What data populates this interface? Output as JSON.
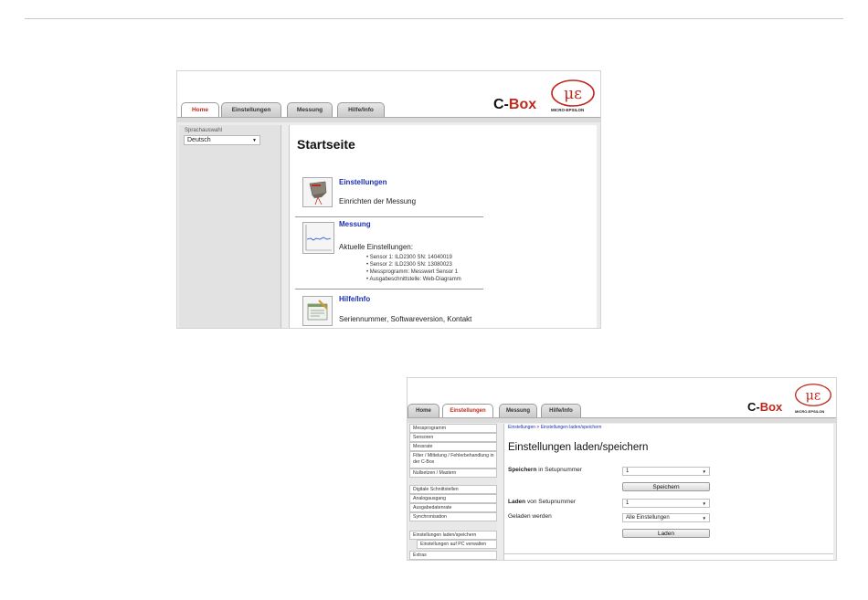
{
  "brand": {
    "prefix": "C-",
    "suffix": "Box",
    "logo_text": "MICRO-EPSILON"
  },
  "tabs": [
    "Home",
    "Einstellungen",
    "Messung",
    "Hilfe/Info"
  ],
  "colors": {
    "accent": "#c0281c",
    "link": "#1a2fb0"
  },
  "home": {
    "language_label": "Sprachauswahl",
    "language_value": "Deutsch",
    "title": "Startseite",
    "items": [
      {
        "icon": "sensor-settings-icon",
        "title": "Einstellungen",
        "desc": "Einrichten der Messung"
      },
      {
        "icon": "measurement-chart-icon",
        "title": "Messung",
        "desc": "Aktuelle Einstellungen:",
        "bullets": [
          "Sensor 1: ILD2300 SN: 14040019",
          "Sensor 2: ILD2300 SN: 13080023",
          "Messprogramm: Messwert Sensor 1",
          "Ausgabeschnittstelle: Web-Diagramm"
        ]
      },
      {
        "icon": "help-info-icon",
        "title": "Hilfe/Info",
        "desc": "Seriennummer, Softwareversion, Kontakt"
      }
    ]
  },
  "settings": {
    "nav_items": [
      "Messprogramm",
      "Sensoren",
      "Messrate",
      "Filter / Mittelung / Fehlerbehandlung in der C-Box",
      "Nullsetzen / Mastern",
      "Digitale Schnittstellen",
      "Analogausgang",
      "Ausgabedatenrate",
      "Synchronisation",
      "Einstellungen laden/speichern",
      "Einstellungen auf PC verwalten",
      "Extras"
    ],
    "breadcrumb": "Einstellungen > Einstellungen laden/speichern",
    "title": "Einstellungen laden/speichern",
    "save_label_bold": "Speichern",
    "save_label_rest": " in Setupnummer",
    "save_value": "1",
    "save_button": "Speichern",
    "load_label_bold": "Laden",
    "load_label_rest": " von Setupnummer",
    "load_value": "1",
    "loaded_label": "Geladen werden",
    "loaded_value": "Alle Einstellungen",
    "load_button": "Laden"
  }
}
